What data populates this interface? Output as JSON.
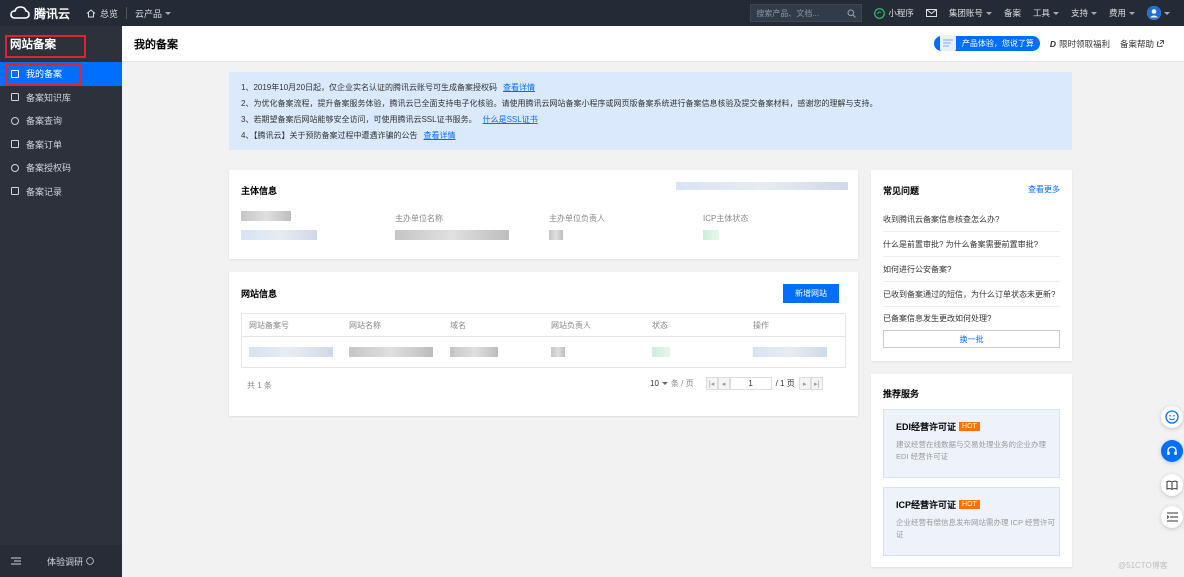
{
  "topbar": {
    "brand": "腾讯云",
    "home": "总览",
    "products": "云产品",
    "search_placeholder": "搜索产品、文档...",
    "mini_program": "小程序",
    "account": "集团账号",
    "beian": "备案",
    "tools": "工具",
    "support": "支持",
    "billing": "费用"
  },
  "sidebar": {
    "title": "网站备案",
    "items": [
      {
        "label": "我的备案",
        "active": true
      },
      {
        "label": "备案知识库"
      },
      {
        "label": "备案查询"
      },
      {
        "label": "备案订单"
      },
      {
        "label": "备案授权码"
      },
      {
        "label": "备案记录"
      }
    ],
    "footer": "体验调研"
  },
  "header": {
    "title": "我的备案",
    "banner": "产品体验，您说了算",
    "limited": "限时领取福利",
    "help": "备案帮助"
  },
  "notice": {
    "line1": "1、2019年10月20日起，仅企业实名认证的腾讯云账号可生成备案授权码",
    "line1_link": "查看详情",
    "line2": "2、为优化备案流程，提升备案服务体验，腾讯云已全面支持电子化核验。请使用腾讯云网站备案小程序或网页版备案系统进行备案信息核验及提交备案材料，感谢您的理解与支持。",
    "line3": "3、若期望备案后网站能够安全访问，可使用腾讯云SSL证书服务。",
    "line3_link": "什么是SSL证书",
    "line4": "4、【腾讯云】关于预防备案过程中遭遇诈骗的公告",
    "line4_link": "查看详情"
  },
  "subject": {
    "title": "主体信息",
    "col2": "主办单位名称",
    "col3": "主办单位负责人",
    "col4": "ICP主体状态"
  },
  "website": {
    "title": "网站信息",
    "new_button": "新增网站",
    "columns": [
      "网站备案号",
      "网站名称",
      "域名",
      "网站负责人",
      "状态",
      "操作"
    ],
    "total": "共 1 条",
    "page_size": "10",
    "per_page": "条 / 页",
    "page": "1",
    "page_total": "/ 1 页"
  },
  "faq": {
    "title": "常见问题",
    "more": "查看更多",
    "items": [
      "收到腾讯云备案信息核查怎么办?",
      "什么是前置审批? 为什么备案需要前置审批?",
      "如何进行公安备案?",
      "已收到备案通过的短信，为什么订单状态未更新?",
      "已备案信息发生更改如何处理?"
    ],
    "refresh": "换一批"
  },
  "services": {
    "title": "推荐服务",
    "items": [
      {
        "name": "EDI经营许可证",
        "badge": "HOT",
        "desc": "建议经营在线数据与交易处理业务的企业办理 EDI 经营许可证"
      },
      {
        "name": "ICP经营许可证",
        "badge": "HOT",
        "desc": "企业经营有偿信息发布网站需办理 ICP 经营许可证"
      }
    ]
  },
  "watermark": "@51CTO博客",
  "colors": {
    "primary": "#006eff",
    "topbar": "#242b36",
    "sidebar": "#2c313c",
    "hot": "#ff7200",
    "highlight": "#e0242c"
  }
}
